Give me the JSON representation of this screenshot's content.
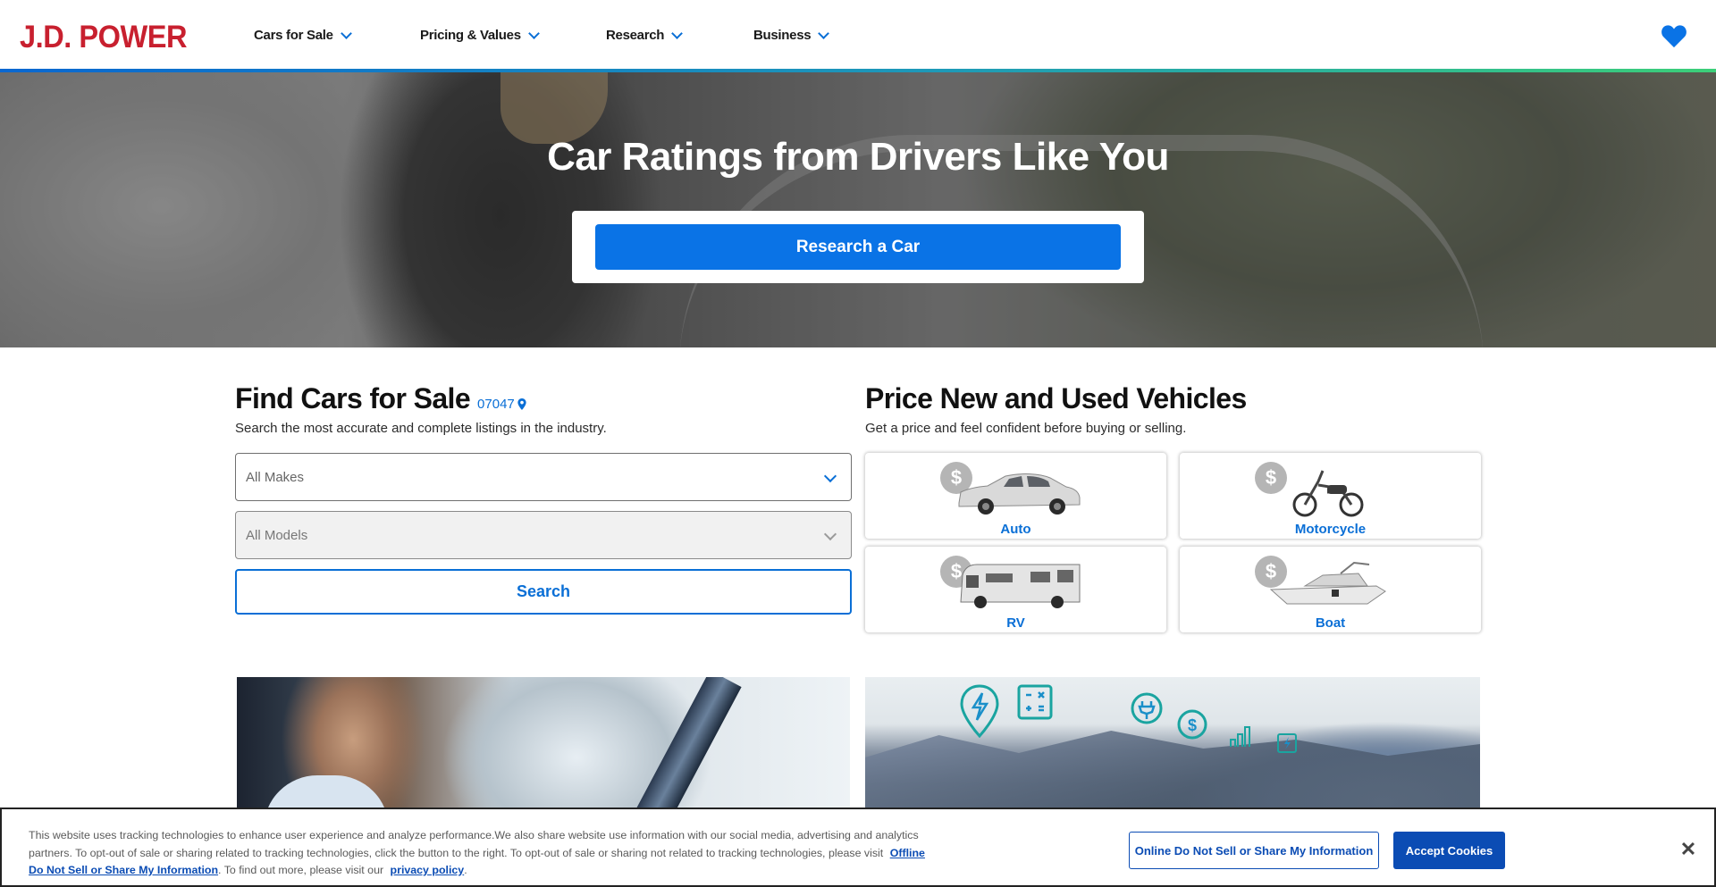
{
  "header": {
    "logo": "J.D. POWER",
    "nav": [
      {
        "label": "Cars for Sale"
      },
      {
        "label": "Pricing & Values"
      },
      {
        "label": "Research"
      },
      {
        "label": "Business"
      }
    ],
    "favorites_icon": "heart-icon",
    "colors": {
      "logo": "#c8202f",
      "accent": "#0a6fd6"
    }
  },
  "hero": {
    "title": "Car Ratings from Drivers Like You",
    "cta_label": "Research a Car"
  },
  "find_cars": {
    "title": "Find Cars for Sale",
    "zip": "07047",
    "subtitle": "Search the most accurate and complete listings in the industry.",
    "makes_select": "All Makes",
    "models_select": "All Models",
    "search_label": "Search"
  },
  "price_vehicles": {
    "title": "Price New and Used Vehicles",
    "subtitle": "Get a price and feel confident before buying or selling.",
    "badge_symbol": "$",
    "tiles": [
      {
        "label": "Auto",
        "icon": "car-icon"
      },
      {
        "label": "Motorcycle",
        "icon": "motorcycle-icon"
      },
      {
        "label": "RV",
        "icon": "rv-icon"
      },
      {
        "label": "Boat",
        "icon": "boat-icon"
      }
    ]
  },
  "cookie_banner": {
    "text": "This website uses tracking technologies to enhance user experience and analyze performance.We also share website use information with our social media, advertising and analytics partners. To opt-out of sale or sharing related to tracking technologies, click the button to the right. To opt-out of sale or sharing not related to tracking technologies, please visit",
    "offline_link": "Offline Do Not Sell or Share My Information",
    "middle_text": ". To find out more, please visit our",
    "privacy_link": "privacy policy",
    "end_text": ".",
    "optout_button": "Online Do Not Sell or Share My Information",
    "accept_button": "Accept Cookies",
    "close_symbol": "✕",
    "colors": {
      "button": "#0b4cb4"
    }
  }
}
